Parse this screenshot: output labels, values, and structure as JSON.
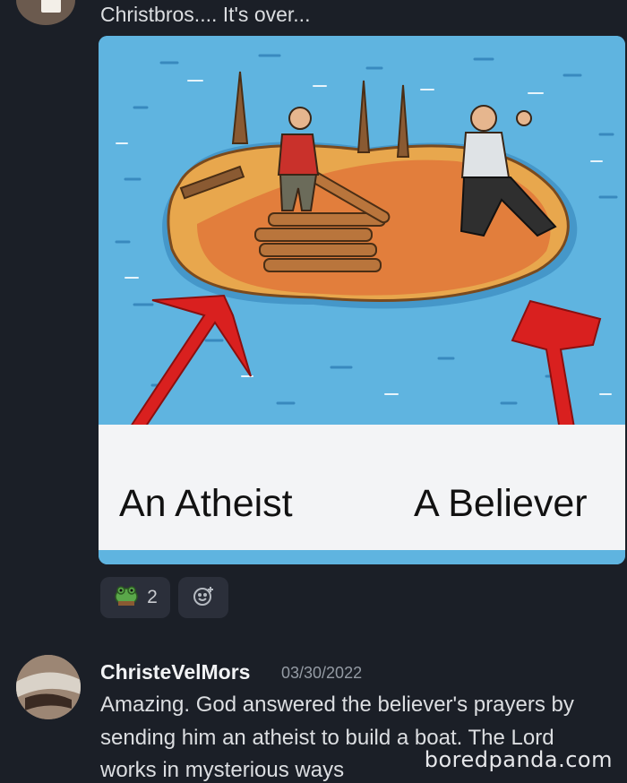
{
  "first_message": {
    "text": "Christbros.... It's over..."
  },
  "image": {
    "caption_left": "An Atheist",
    "caption_right": "A Believer"
  },
  "reactions": [
    {
      "emoji": "frog-emoji",
      "count": "2"
    },
    {
      "emoji": "add-reaction-icon"
    }
  ],
  "reply": {
    "username": "ChristeVelMors",
    "timestamp": "03/30/2022",
    "lines": [
      "Amazing. God answered the believer's prayers by",
      "sending him an atheist to build a boat. The Lord",
      "works in mysterious ways"
    ]
  },
  "watermark": "boredpanda.com"
}
